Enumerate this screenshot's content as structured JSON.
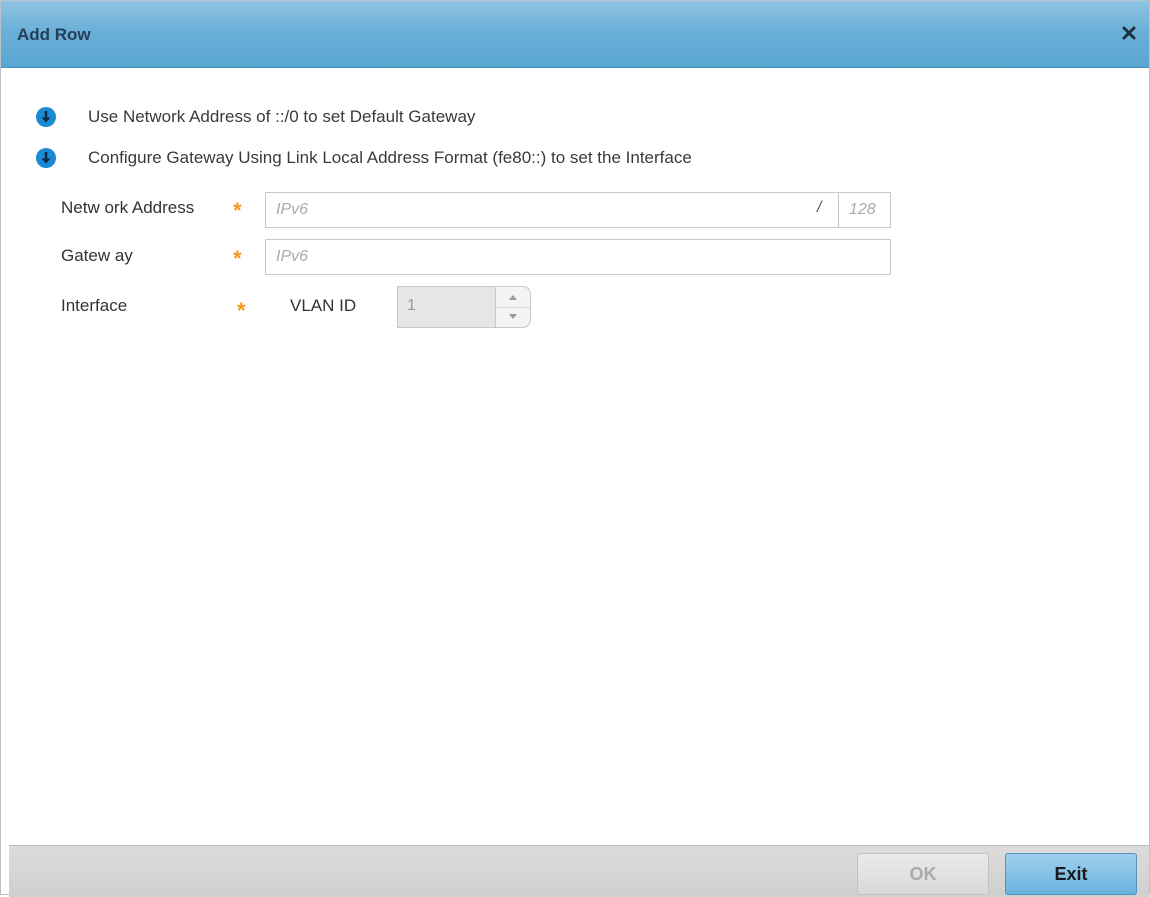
{
  "dialog": {
    "title": "Add Row",
    "close_icon": "close-icon"
  },
  "info": [
    {
      "icon": "info-down-arrow-icon",
      "text": "Use Network Address of ::/0 to set Default Gateway"
    },
    {
      "icon": "info-down-arrow-icon",
      "text": "Configure Gateway Using Link Local Address Format (fe80::) to set the Interface"
    }
  ],
  "form": {
    "network_address": {
      "label": "Netw ork Address",
      "placeholder": "IPv6",
      "value": "",
      "separator": "/",
      "prefix_placeholder": "128",
      "prefix_value": ""
    },
    "gateway": {
      "label": "Gatew ay",
      "placeholder": "IPv6",
      "value": ""
    },
    "interface": {
      "label": "Interface",
      "vlan_label": "VLAN ID",
      "vlan_value": "1"
    },
    "required_marker": "*"
  },
  "footer": {
    "ok_label": "OK",
    "exit_label": "Exit"
  },
  "colors": {
    "title_bar": "#6ab0d8",
    "info_icon": "#1a8ad4",
    "required": "#f39a1e",
    "exit_button": "#6ab3de"
  }
}
